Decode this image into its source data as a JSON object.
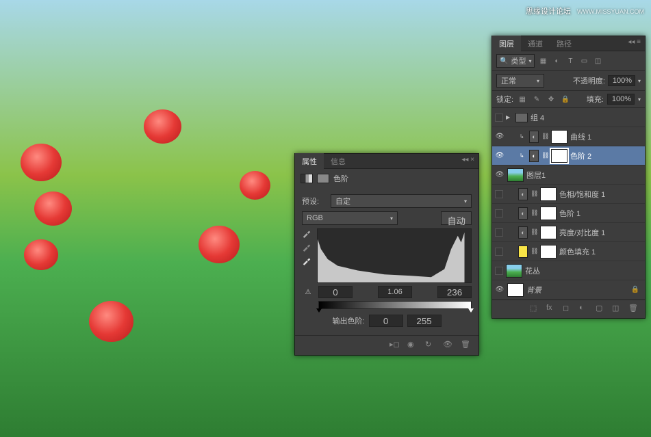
{
  "watermark": {
    "text": "思缘设计论坛",
    "url": "WWW.MISSYUAN.COM"
  },
  "properties_panel": {
    "tabs": {
      "properties": "属性",
      "info": "信息"
    },
    "title": "色阶",
    "preset_label": "预设:",
    "preset_value": "自定",
    "channel": "RGB",
    "auto_button": "自动",
    "input_values": {
      "black": "0",
      "gamma": "1.06",
      "white": "236"
    },
    "output_label": "输出色阶:",
    "output_values": {
      "black": "0",
      "white": "255"
    }
  },
  "layers_panel": {
    "tabs": {
      "layers": "图层",
      "channels": "通道",
      "paths": "路径"
    },
    "kind_label": "类型",
    "blend_mode": "正常",
    "opacity_label": "不透明度:",
    "opacity_value": "100%",
    "lock_label": "锁定:",
    "fill_label": "填充:",
    "fill_value": "100%",
    "layers": [
      {
        "name": "组 4",
        "type": "group"
      },
      {
        "name": "曲线 1",
        "type": "adjustment"
      },
      {
        "name": "色阶 2",
        "type": "adjustment",
        "selected": true
      },
      {
        "name": "图层1",
        "type": "image"
      },
      {
        "name": "色相/饱和度 1",
        "type": "adjustment"
      },
      {
        "name": "色阶 1",
        "type": "adjustment"
      },
      {
        "name": "亮度/对比度 1",
        "type": "adjustment"
      },
      {
        "name": "颜色填充 1",
        "type": "fill",
        "color": "yellow"
      },
      {
        "name": "花丛",
        "type": "image"
      },
      {
        "name": "背景",
        "type": "background",
        "locked": true
      }
    ]
  }
}
